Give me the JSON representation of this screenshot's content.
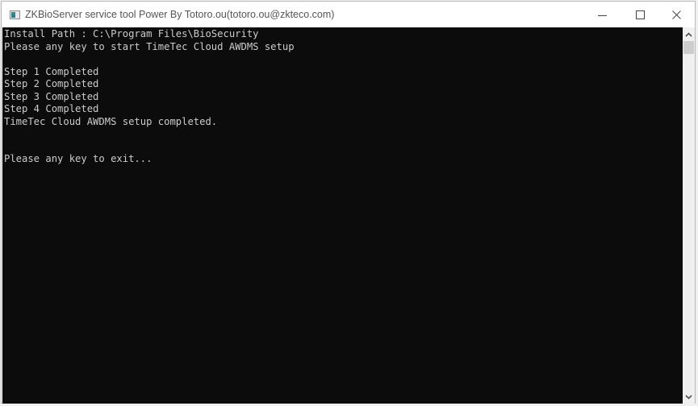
{
  "window": {
    "title": "ZKBioServer service tool Power By Totoro.ou(totoro.ou@zkteco.com)",
    "icon": "console-app-icon",
    "controls": {
      "minimize": "minimize-icon",
      "maximize": "maximize-icon",
      "close": "close-icon"
    }
  },
  "console": {
    "lines": [
      "Install Path : C:\\Program Files\\BioSecurity",
      "Please any key to start TimeTec Cloud AWDMS setup",
      "",
      "Step 1 Completed",
      "Step 2 Completed",
      "Step 3 Completed",
      "Step 4 Completed",
      "TimeTec Cloud AWDMS setup completed.",
      "",
      "",
      "Please any key to exit..."
    ]
  },
  "scrollbar": {
    "up": "chevron-up-icon",
    "down": "chevron-down-icon"
  }
}
